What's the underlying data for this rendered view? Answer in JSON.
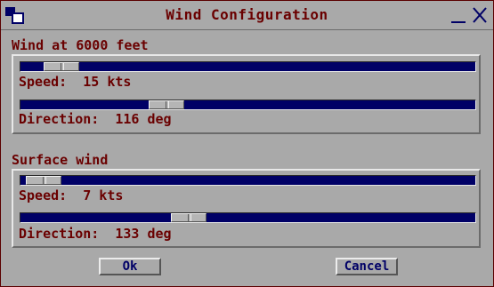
{
  "window": {
    "title": "Wind Configuration"
  },
  "altitude_wind": {
    "label": "Wind at  6000  feet",
    "speed": {
      "text": "Speed:  15 kts",
      "position_fraction": 0.09
    },
    "direction": {
      "text": "Direction:  116 deg",
      "position_fraction": 0.32
    }
  },
  "surface_wind": {
    "label": "Surface wind",
    "speed": {
      "text": "Speed:  7 kts",
      "position_fraction": 0.05
    },
    "direction": {
      "text": "Direction:  133 deg",
      "position_fraction": 0.37
    }
  },
  "buttons": {
    "ok": "Ok",
    "cancel": "Cancel"
  },
  "colors": {
    "text": "#6a0000",
    "track": "#000066",
    "background": "#a9a9a9"
  },
  "icons": {
    "app": "window-menu-icon",
    "minimize": "minimize-icon",
    "close": "close-icon"
  }
}
